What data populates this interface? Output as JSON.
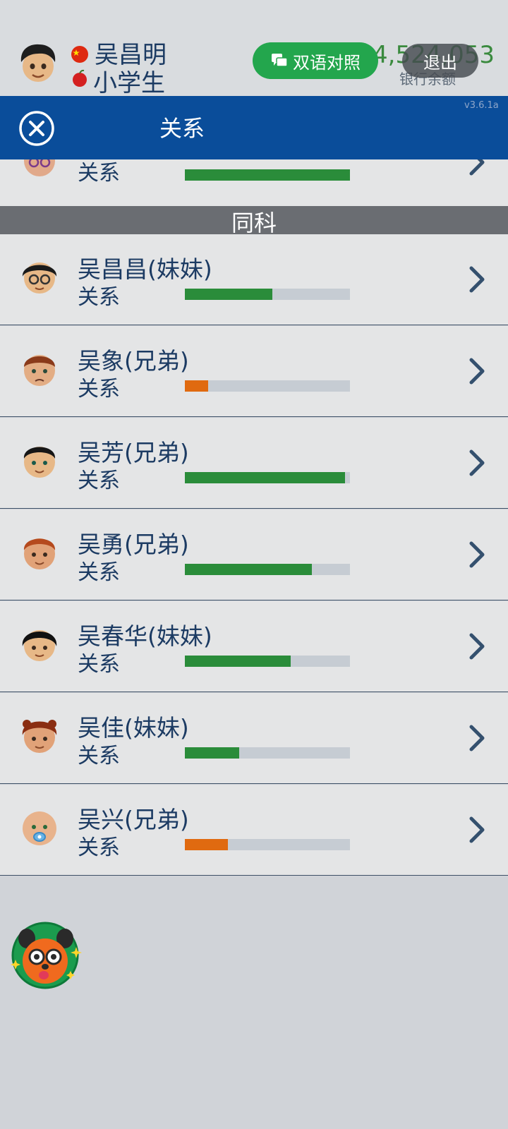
{
  "header": {
    "player_name": "吴昌明",
    "player_title": "小学生",
    "balance": "4,524,053",
    "balance_label": "银行余额",
    "bilingual_label": "双语对照",
    "exit_label": "退出",
    "version": "v3.6.1a"
  },
  "titlebar": {
    "title": "关系"
  },
  "partial_row": {
    "rel_label": "关系",
    "relationship": 1.0,
    "bar_color": "#2a8c3a"
  },
  "section": {
    "label": "同科"
  },
  "siblings": [
    {
      "name": "吴昌昌(妹妹)",
      "rel_label": "关系",
      "relationship": 0.53,
      "bar_color": "#2a8c3a",
      "avatar": "glasses-girl-avatar"
    },
    {
      "name": "吴象(兄弟)",
      "rel_label": "关系",
      "relationship": 0.14,
      "bar_color": "#e06a10",
      "avatar": "sad-boy-avatar"
    },
    {
      "name": "吴芳(兄弟)",
      "rel_label": "关系",
      "relationship": 0.97,
      "bar_color": "#2a8c3a",
      "avatar": "dark-hair-boy-avatar"
    },
    {
      "name": "吴勇(兄弟)",
      "rel_label": "关系",
      "relationship": 0.77,
      "bar_color": "#2a8c3a",
      "avatar": "red-hair-boy-avatar"
    },
    {
      "name": "吴春华(妹妹)",
      "rel_label": "关系",
      "relationship": 0.64,
      "bar_color": "#2a8c3a",
      "avatar": "black-hair-girl-avatar"
    },
    {
      "name": "吴佳(妹妹)",
      "rel_label": "关系",
      "relationship": 0.33,
      "bar_color": "#2a8c3a",
      "avatar": "curly-hair-girl-avatar"
    },
    {
      "name": "吴兴(兄弟)",
      "rel_label": "关系",
      "relationship": 0.26,
      "bar_color": "#e06a10",
      "avatar": "baby-avatar"
    }
  ]
}
